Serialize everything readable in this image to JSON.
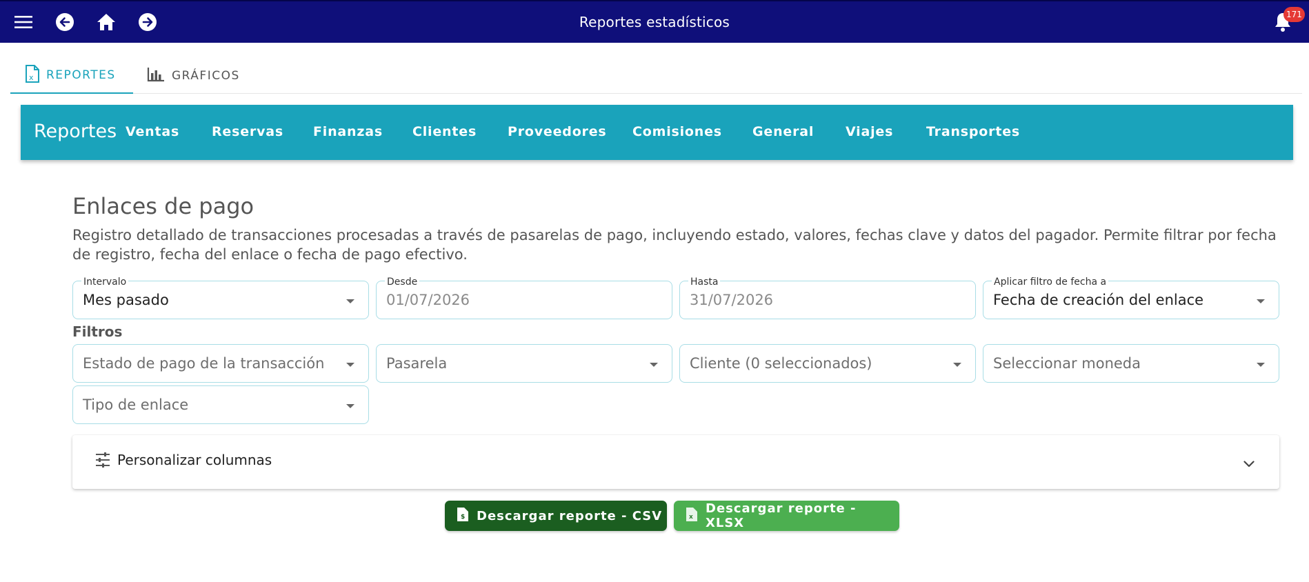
{
  "app": {
    "title": "Reportes estadísticos",
    "notifications_count": "171"
  },
  "tabs": [
    {
      "label": "REPORTES",
      "active": true
    },
    {
      "label": "GRÁFICOS",
      "active": false
    }
  ],
  "report_nav": {
    "brand": "Reportes",
    "links": [
      "Ventas",
      "Reservas",
      "Finanzas",
      "Clientes",
      "Proveedores",
      "Comisiones",
      "General",
      "Viajes",
      "Transportes"
    ]
  },
  "page": {
    "title": "Enlaces de pago",
    "description": "Registro detallado de transacciones procesadas a través de pasarelas de pago, incluyendo estado, valores, fechas clave y datos del pagador. Permite filtrar por fecha de registro, fecha del enlace o fecha de pago efectivo."
  },
  "date_filters": {
    "interval": {
      "label": "Intervalo",
      "value": "Mes pasado"
    },
    "from": {
      "label": "Desde",
      "value": "01/07/2026"
    },
    "to": {
      "label": "Hasta",
      "value": "31/07/2026"
    },
    "apply_to": {
      "label": "Aplicar filtro de fecha a",
      "value": "Fecha de creación del enlace"
    }
  },
  "filters": {
    "heading": "Filtros",
    "payment_status": {
      "placeholder": "Estado de pago de la transacción"
    },
    "gateway": {
      "placeholder": "Pasarela"
    },
    "client": {
      "placeholder": "Cliente (0 seleccionados)"
    },
    "currency": {
      "placeholder": "Seleccionar moneda"
    },
    "link_type": {
      "placeholder": "Tipo de enlace"
    }
  },
  "columns_panel": {
    "title": "Personalizar columnas"
  },
  "actions": {
    "csv": {
      "label": "Descargar reporte - CSV",
      "color": "#1b5e20"
    },
    "xlsx": {
      "label": "Descargar reporte - XLSX",
      "color": "#4caf50"
    }
  },
  "colors": {
    "topbar": "#0f0f7a",
    "accent": "#1aa3bb",
    "badge": "#e53935"
  }
}
